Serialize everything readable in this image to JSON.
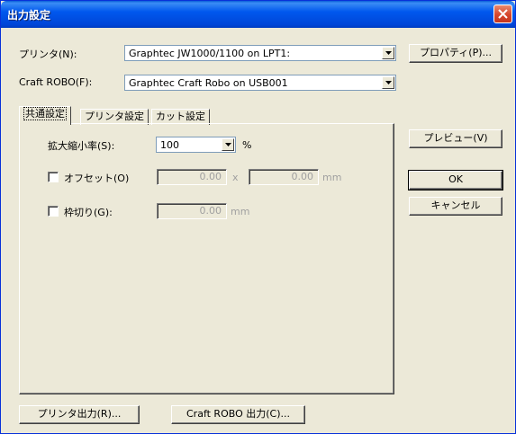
{
  "window": {
    "title": "出力設定"
  },
  "printer": {
    "label": "プリンタ(N):",
    "value": "Graphtec JW1000/1100 on LPT1:",
    "properties_label": "プロパティ(P)..."
  },
  "craft": {
    "label": "Craft ROBO(F):",
    "value": "Graphtec Craft Robo on USB001"
  },
  "tabs": [
    {
      "label": "共通設定",
      "active": true
    },
    {
      "label": "プリンタ設定",
      "active": false
    },
    {
      "label": "カット設定",
      "active": false
    }
  ],
  "scale": {
    "label": "拡大縮小率(S):",
    "value": "100",
    "unit": "%"
  },
  "offset": {
    "label": "オフセット(O)",
    "x": "0.00",
    "separator": "x",
    "y": "0.00",
    "unit": "mm"
  },
  "frame": {
    "label": "枠切り(G):",
    "value": "0.00",
    "unit": "mm"
  },
  "buttons": {
    "preview": "プレビュー(V)",
    "ok": "OK",
    "cancel": "キャンセル",
    "printer_output": "プリンタ出力(R)...",
    "craft_output": "Craft ROBO 出力(C)..."
  },
  "colors": {
    "titlebar": "#0058ee",
    "close": "#d5452c",
    "face": "#ece9d8"
  }
}
